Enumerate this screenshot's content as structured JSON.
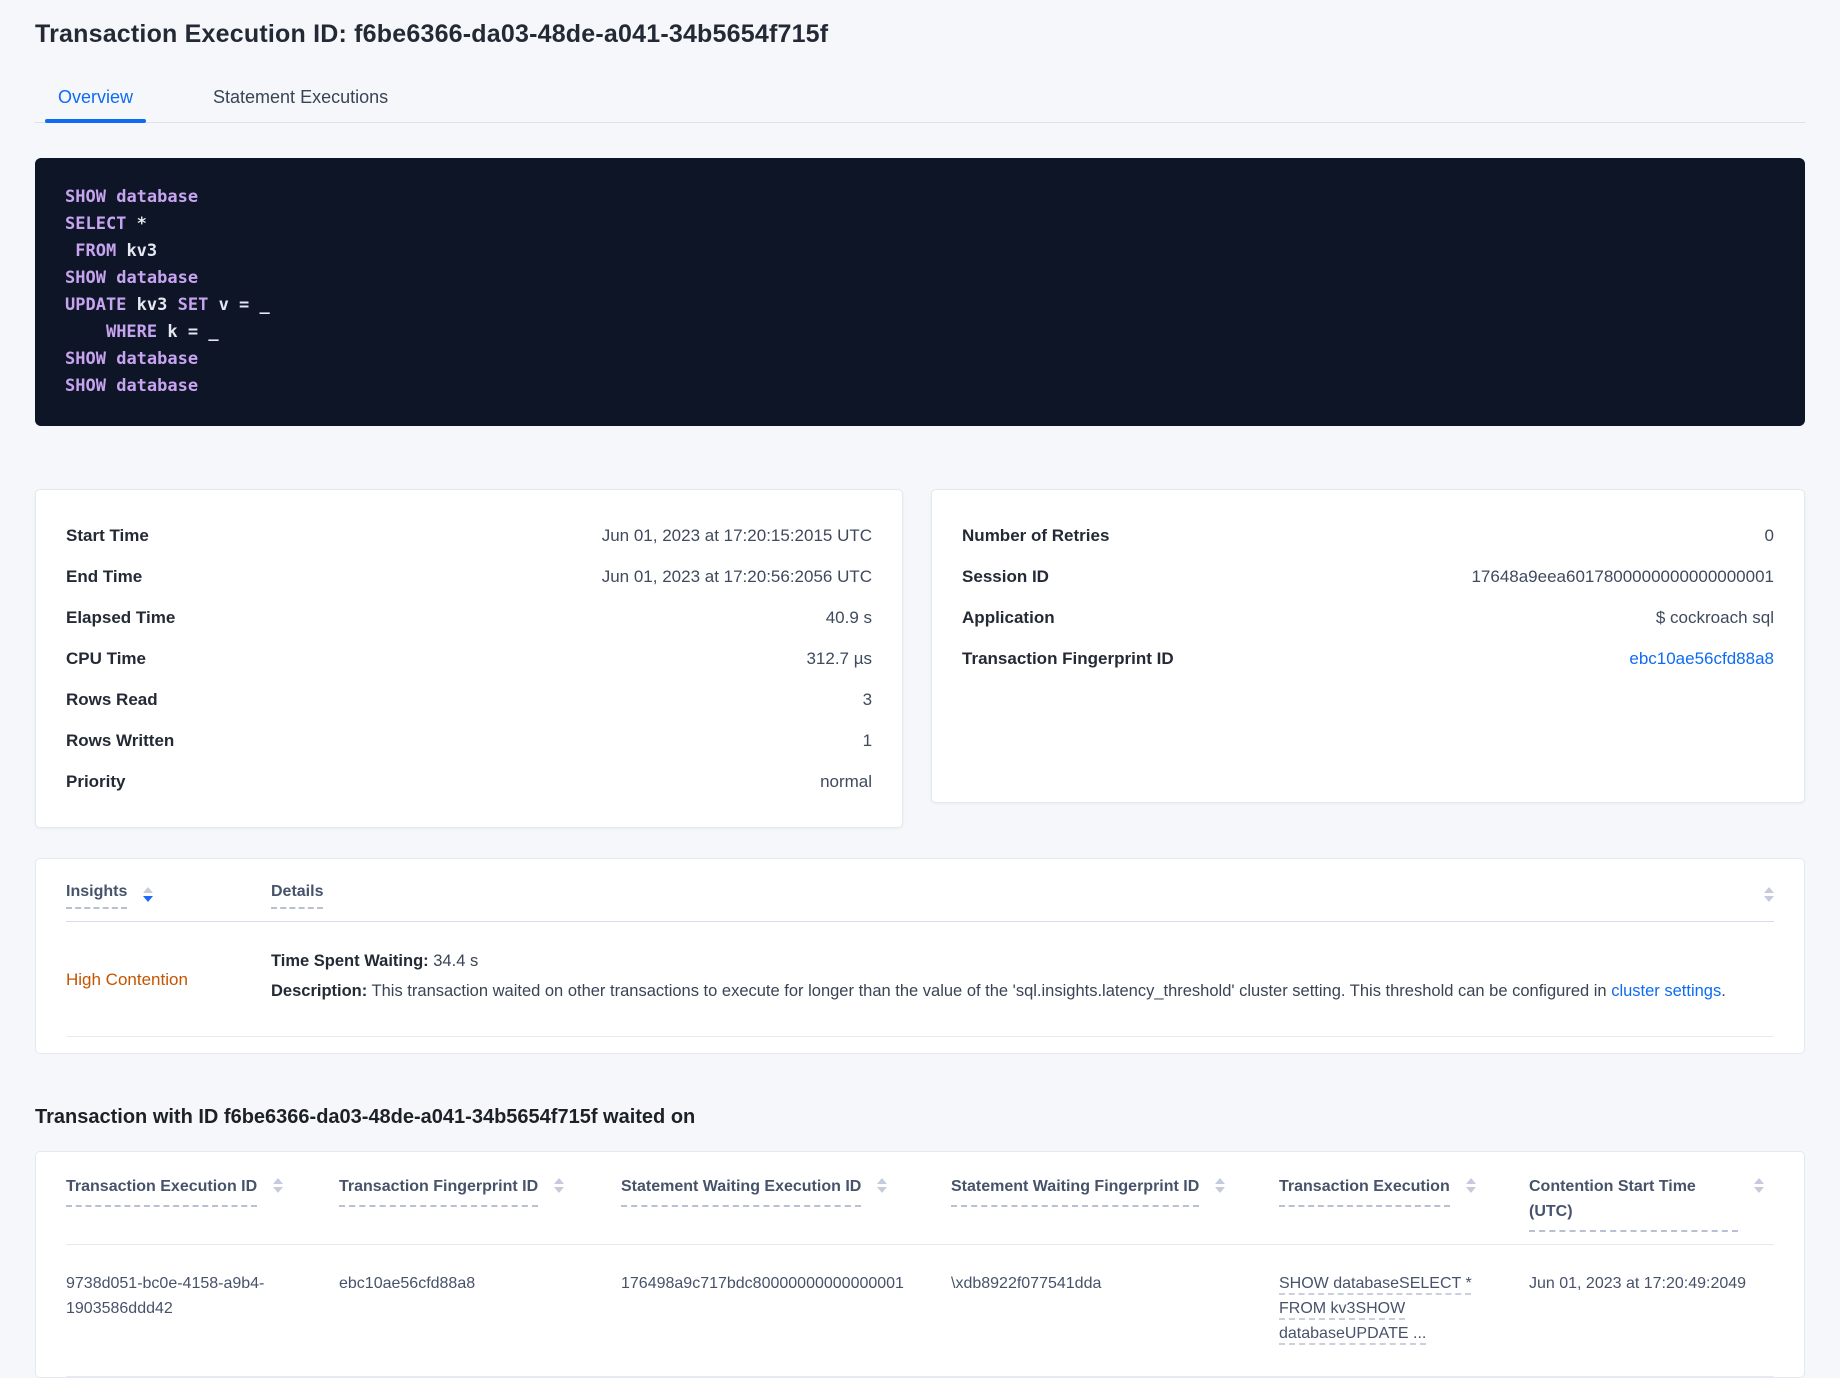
{
  "colors": {
    "accent_blue": "#0e6bf3",
    "insight_orange": "#c45500",
    "code_background": "#0d1526",
    "code_keyword": "#c7a4f0",
    "code_plain": "#e6e8f2",
    "page_background": "#f5f7fa"
  },
  "header": {
    "title": "Transaction Execution ID: f6be6366-da03-48de-a041-34b5654f715f"
  },
  "tabs": {
    "overview": "Overview",
    "statement_executions": "Statement Executions"
  },
  "sql_lines": [
    {
      "a": "SHOW",
      "b": " ",
      "c": "database"
    },
    {
      "a": "SELECT",
      "b": " *"
    },
    {
      "a": " ",
      "b": "FROM",
      "c": " kv3"
    },
    {
      "a": "SHOW",
      "b": " ",
      "c": "database"
    },
    {
      "a": "UPDATE",
      "b": " kv3 ",
      "c": "SET",
      "d": " v = _"
    },
    {
      "a": "    ",
      "b": "WHERE",
      "c": " k = _"
    },
    {
      "a": "SHOW",
      "b": " ",
      "c": "database"
    },
    {
      "a": "SHOW",
      "b": " ",
      "c": "database"
    }
  ],
  "txn_stats": {
    "rows": [
      {
        "label": "Start Time",
        "value": "Jun 01, 2023 at 17:20:15:2015 UTC"
      },
      {
        "label": "End Time",
        "value": "Jun 01, 2023 at 17:20:56:2056 UTC"
      },
      {
        "label": "Elapsed Time",
        "value": "40.9 s"
      },
      {
        "label": "CPU Time",
        "value": "312.7 µs"
      },
      {
        "label": "Rows Read",
        "value": "3"
      },
      {
        "label": "Rows Written",
        "value": "1"
      },
      {
        "label": "Priority",
        "value": "normal"
      }
    ]
  },
  "txn_meta": {
    "rows": [
      {
        "label": "Number of Retries",
        "value": "0"
      },
      {
        "label": "Session ID",
        "value": "17648a9eea6017800000000000000001"
      },
      {
        "label": "Application",
        "value": "$ cockroach sql"
      },
      {
        "label": "Transaction Fingerprint ID",
        "value": "ebc10ae56cfd88a8"
      }
    ]
  },
  "insights": {
    "columns": {
      "insight": "Insights",
      "details": "Details"
    },
    "row": {
      "insight": "High Contention",
      "waiting_label": "Time Spent Waiting:",
      "waiting_value": " 34.4 s",
      "description_label": "Description:",
      "description_text": " This transaction waited on other transactions to execute for longer than the value of the 'sql.insights.latency_threshold' cluster setting. This threshold can be configured in ",
      "link": "cluster settings",
      "suffix": "."
    }
  },
  "waited_on": {
    "heading": "Transaction with ID f6be6366-da03-48de-a041-34b5654f715f waited on",
    "columns": [
      "Transaction Execution ID",
      "Transaction Fingerprint ID",
      "Statement Waiting Execution ID",
      "Statement Waiting Fingerprint ID",
      "Transaction Execution",
      "Contention Start Time (UTC)"
    ],
    "row": {
      "transaction_execution_id": "9738d051-bc0e-4158-a9b4-1903586ddd42",
      "transaction_fingerprint_id": "ebc10ae56cfd88a8",
      "statement_waiting_execution_id": "176498a9c717bdc80000000000000001",
      "statement_waiting_fingerprint_id": "\\xdb8922f077541dda",
      "transaction_execution": "SHOW databaseSELECT * FROM kv3SHOW databaseUPDATE ...",
      "contention_start_time": "Jun 01, 2023 at 17:20:49:2049"
    }
  }
}
